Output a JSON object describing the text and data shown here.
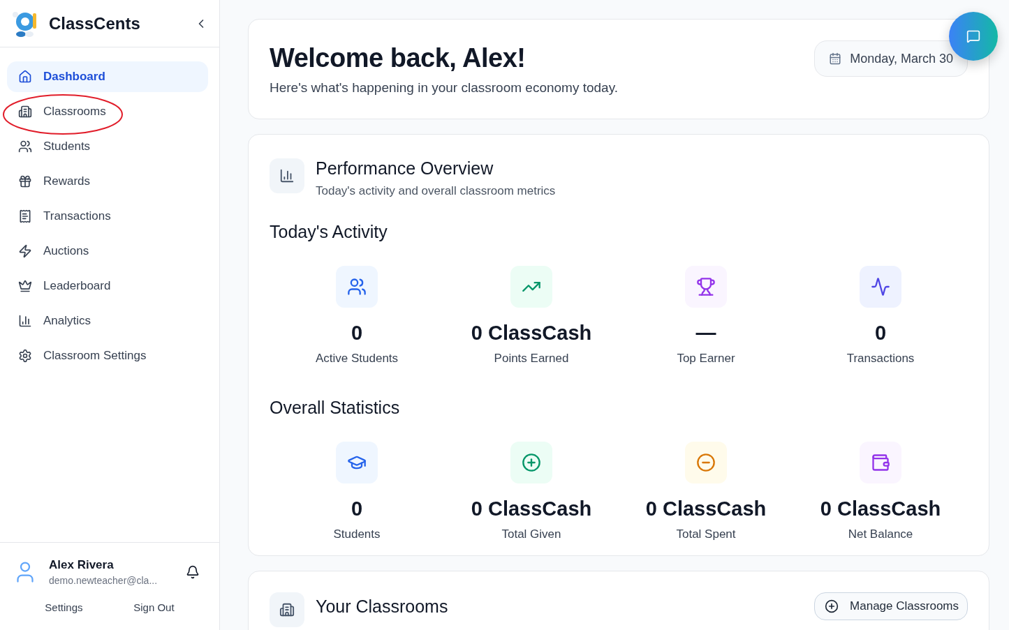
{
  "sidebar": {
    "brand": "ClassCents",
    "items": [
      {
        "label": "Dashboard",
        "kind": "home",
        "selected": true,
        "annotated": false
      },
      {
        "label": "Classrooms",
        "kind": "building",
        "selected": false,
        "annotated": true
      },
      {
        "label": "Students",
        "kind": "users",
        "selected": false,
        "annotated": false
      },
      {
        "label": "Rewards",
        "kind": "gift",
        "selected": false,
        "annotated": false
      },
      {
        "label": "Transactions",
        "kind": "receipt",
        "selected": false,
        "annotated": false
      },
      {
        "label": "Auctions",
        "kind": "zap",
        "selected": false,
        "annotated": false
      },
      {
        "label": "Leaderboard",
        "kind": "crown",
        "selected": false,
        "annotated": false
      },
      {
        "label": "Analytics",
        "kind": "chart",
        "selected": false,
        "annotated": false
      },
      {
        "label": "Classroom Settings",
        "kind": "settings",
        "selected": false,
        "annotated": false
      }
    ],
    "user": {
      "name": "Alex Rivera",
      "email": "demo.newteacher@cla..."
    },
    "footer_links": [
      "Settings",
      "Sign Out"
    ]
  },
  "welcome": {
    "title": "Welcome back, Alex!",
    "subtitle": "Here's what's happening in your classroom economy today.",
    "date": "Monday, March 30"
  },
  "performance": {
    "title": "Performance Overview",
    "subtitle": "Today's activity and overall classroom metrics",
    "sections": [
      {
        "title": "Today's Activity",
        "stats": [
          {
            "kind": "users",
            "value": "0",
            "label": "Active Students"
          },
          {
            "kind": "trending",
            "value": "0 ClassCash",
            "label": "Points Earned"
          },
          {
            "kind": "trophy",
            "value": "—",
            "label": "Top Earner"
          },
          {
            "kind": "activity",
            "value": "0",
            "label": "Transactions"
          }
        ]
      },
      {
        "title": "Overall Statistics",
        "stats": [
          {
            "kind": "graduation",
            "value": "0",
            "label": "Students"
          },
          {
            "kind": "plus",
            "value": "0 ClassCash",
            "label": "Total Given"
          },
          {
            "kind": "minus",
            "value": "0 ClassCash",
            "label": "Total Spent"
          },
          {
            "kind": "wallet",
            "value": "0 ClassCash",
            "label": "Net Balance"
          }
        ]
      }
    ]
  },
  "classrooms": {
    "title": "Your Classrooms",
    "button": "Manage Classrooms"
  }
}
